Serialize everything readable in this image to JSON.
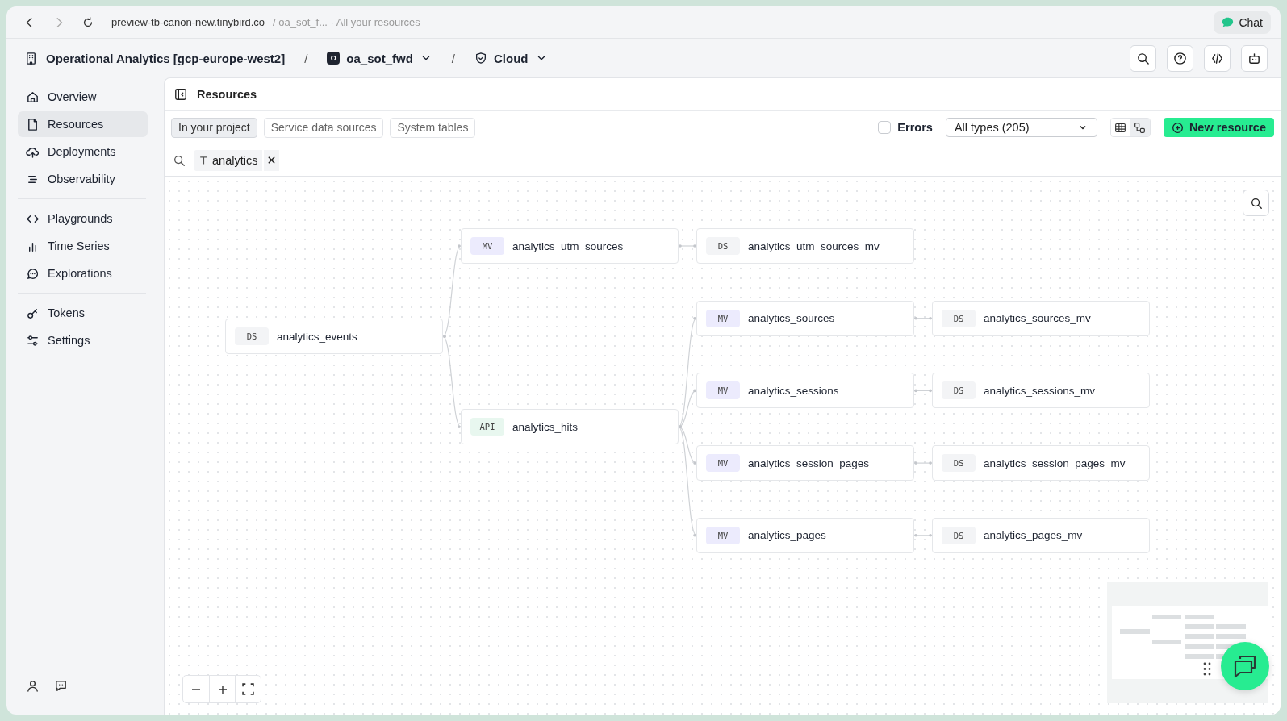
{
  "browser": {
    "url": "preview-tb-canon-new.tinybird.co",
    "path": "/ oa_sot_f... · All your resources",
    "chat_button": "Chat"
  },
  "header": {
    "organization": "Operational Analytics [gcp-europe-west2]",
    "separator_1": "/",
    "workspace_badge": "O",
    "workspace": "oa_sot_fwd",
    "separator_2": "/",
    "environment": "Cloud"
  },
  "sidebar": {
    "groups": [
      [
        {
          "label": "Overview",
          "kind": "home",
          "selected": false
        },
        {
          "label": "Resources",
          "kind": "file",
          "selected": true
        },
        {
          "label": "Deployments",
          "kind": "cloud",
          "selected": false
        },
        {
          "label": "Observability",
          "kind": "list",
          "selected": false
        }
      ],
      [
        {
          "label": "Playgrounds",
          "kind": "code",
          "selected": false
        },
        {
          "label": "Time Series",
          "kind": "chart",
          "selected": false
        },
        {
          "label": "Explorations",
          "kind": "chat",
          "selected": false
        }
      ],
      [
        {
          "label": "Tokens",
          "kind": "key",
          "selected": false
        },
        {
          "label": "Settings",
          "kind": "sliders",
          "selected": false
        }
      ]
    ]
  },
  "panel": {
    "title": "Resources",
    "tabs": [
      {
        "label": "In your project",
        "selected": true
      },
      {
        "label": "Service data sources",
        "selected": false
      },
      {
        "label": "System tables",
        "selected": false
      }
    ],
    "errors_filter": {
      "label": "Errors",
      "checked": false
    },
    "type_select": {
      "value": "All types (205)"
    },
    "views": [
      {
        "kind": "table",
        "selected": false
      },
      {
        "kind": "graph",
        "selected": true
      }
    ],
    "new_button": "New resource",
    "filter_chip": "analytics"
  },
  "graph": {
    "root": {
      "type": "DS",
      "name": "analytics_events",
      "children": [
        {
          "type": "MV",
          "name": "analytics_utm_sources",
          "children": [
            {
              "type": "DS",
              "name": "analytics_utm_sources_mv"
            }
          ]
        },
        {
          "type": "API",
          "name": "analytics_hits",
          "children": [
            {
              "type": "MV",
              "name": "analytics_sources",
              "children": [
                {
                  "type": "DS",
                  "name": "analytics_sources_mv"
                }
              ]
            },
            {
              "type": "MV",
              "name": "analytics_sessions",
              "children": [
                {
                  "type": "DS",
                  "name": "analytics_sessions_mv"
                }
              ]
            },
            {
              "type": "MV",
              "name": "analytics_session_pages",
              "children": [
                {
                  "type": "DS",
                  "name": "analytics_session_pages_mv"
                }
              ]
            },
            {
              "type": "MV",
              "name": "analytics_pages",
              "children": [
                {
                  "type": "DS",
                  "name": "analytics_pages_mv"
                }
              ]
            }
          ]
        }
      ]
    }
  }
}
